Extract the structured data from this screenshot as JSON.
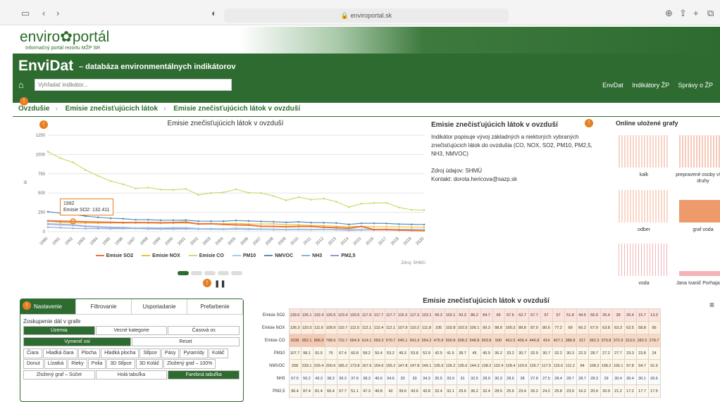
{
  "browser": {
    "url": "enviroportal.sk"
  },
  "site": {
    "logo_left": "enviro",
    "logo_right": "portál",
    "logo_sub": "Informačný portál rezortu MŽP SR",
    "app_title": "EnviDat",
    "app_subtitle": "– databáza environmentálnych indikátorov",
    "search_placeholder": "Vyhľadať indikátor...",
    "links": [
      "EnvDat",
      "Indikátory ŽP",
      "Správy o ŽP"
    ]
  },
  "breadcrumbs": [
    "Ovzdušie",
    "Emisie znečisťujúcich látok",
    "Emisie znečisťujúcich látok v ovzduší"
  ],
  "chart_data": {
    "type": "line",
    "title": "Emisie znečisťujúcich látok v ovzduší",
    "ylabel": "kt",
    "x": [
      1990,
      1991,
      1992,
      1993,
      1994,
      1995,
      1996,
      1997,
      1998,
      1999,
      2000,
      2001,
      2002,
      2003,
      2004,
      2005,
      2006,
      2007,
      2008,
      2009,
      2010,
      2011,
      2012,
      2013,
      2014,
      2015,
      2016,
      2017,
      2018,
      2019,
      2020
    ],
    "ylim": [
      0,
      1250
    ],
    "yticks": [
      0,
      250,
      500,
      750,
      1000,
      1250
    ],
    "grid": true,
    "legend": "bottom",
    "series": [
      {
        "name": "Emisie SO2",
        "color": "#e8743b",
        "values": [
          139.6,
          135.1,
          132.4,
          126.5,
          123.4,
          120.5,
          117.9,
          117.7,
          117.7,
          115.3,
          117.3,
          123.1,
          99.3,
          102.1,
          93.3,
          86.2,
          84.7,
          69,
          67.6,
          62.7,
          67.7,
          67,
          57,
          51.8,
          44.5,
          66.9,
          26.4,
          28,
          20.4,
          15.7,
          13.3
        ]
      },
      {
        "name": "Emisie NOX",
        "color": "#f2c037",
        "values": [
          136.3,
          120.3,
          111.6,
          109.9,
          110.7,
          112.5,
          112.1,
          112.4,
          112.1,
          107.9,
          110.2,
          111.8,
          105,
          102.8,
          102.5,
          106.1,
          99.3,
          98.8,
          100.3,
          89.8,
          87.9,
          80.6,
          77.2,
          69,
          66.2,
          67.9,
          63.8,
          63.3,
          62.5,
          58.8,
          56
        ]
      },
      {
        "name": "Emisie CO",
        "color": "#c9dd74",
        "values": [
          1036,
          952.1,
          896.9,
          798.6,
          722.7,
          654.9,
          614.1,
          559.3,
          570.7,
          545.1,
          541.6,
          554.2,
          475.9,
          500.8,
          508.2,
          548.8,
          503.8,
          500,
          461.5,
          405.4,
          446.8,
          414,
          427.1,
          388.8,
          317,
          362.3,
          370.8,
          372.9,
          313.6,
          282.5,
          278.7
        ]
      },
      {
        "name": "PM10",
        "color": "#9ed2e8",
        "values": [
          107.7,
          98.1,
          91.5,
          76,
          67.4,
          60.8,
          58.2,
          50.4,
          53.2,
          49.3,
          53.8,
          52.9,
          42.5,
          41.5,
          38.7,
          45,
          40.9,
          36.2,
          33.2,
          30.7,
          32.9,
          30.7,
          32.2,
          30.3,
          22.3,
          28.7,
          27.2,
          27.7,
          23.3,
          23.8,
          24
        ]
      },
      {
        "name": "NMVOC",
        "color": "#5a8fbd",
        "values": [
          258,
          239.1,
          226.4,
          200.6,
          185.2,
          173.8,
          167.6,
          154.6,
          155.2,
          147.8,
          147.8,
          149.1,
          135.9,
          135.2,
          135.6,
          144.3,
          138.2,
          132.4,
          128.4,
          120.6,
          126.7,
          117.5,
          115.6,
          111.2,
          94,
          108.3,
          108.2,
          106.1,
          97.8,
          94.7,
          91.6
        ]
      },
      {
        "name": "NH3",
        "color": "#8bb1d6",
        "values": [
          57.5,
          50.2,
          43.3,
          38.3,
          39.3,
          37.9,
          38.3,
          40.6,
          34.6,
          33,
          33,
          34.3,
          35.5,
          33.9,
          31,
          32.5,
          28.9,
          30.3,
          28.6,
          28,
          27.8,
          27.5,
          28.4,
          28.7,
          28.7,
          28.3,
          29,
          30.4,
          30.4,
          30.1,
          26.6
        ]
      },
      {
        "name": "PM2,5",
        "color": "#a78bd8",
        "values": [
          96.4,
          87.4,
          81.4,
          66.4,
          57.7,
          51.1,
          47.3,
          40.8,
          42,
          39.6,
          43.6,
          42.8,
          32.4,
          32.1,
          29.6,
          36.2,
          32.4,
          28.5,
          25.6,
          23.4,
          26.2,
          24.2,
          25.8,
          23.9,
          16.2,
          20.9,
          20.9,
          21.2,
          17.2,
          17.7,
          17.5
        ]
      }
    ],
    "tooltip": {
      "year": "1992",
      "text": "Emisie SO2: 132.411"
    },
    "source": "Zdroj: SHMÚ"
  },
  "info": {
    "title": "Emisie znečisťujúcich látok v ovzduší",
    "desc": "Indikátor popisuje vývoj základných a niektorých vybraných znečisťujúcich látok do ovzdušia (CO, NOX, SO2, PM10, PM2,5, NH3, NMVOC)",
    "source": "Zdroj údajov: SHMÚ",
    "contact": "Kontakt: dorota.hericova@sazp.sk"
  },
  "saved": {
    "title": "Online uložené grafy",
    "items": [
      "kalk",
      "prepravené osoby všetky druhy",
      "odber",
      "graf voda",
      "voda",
      "Jana Ivanič Porhajašová"
    ]
  },
  "panel": {
    "tabs": [
      "Nastavenie",
      "Filtrovanie",
      "Usporiadanie",
      "Prefarbenie"
    ],
    "group_label": "Zoskupenie dát v grafe",
    "group": [
      "Územia",
      "Vecné kategorie",
      "Časová os"
    ],
    "swap": "Vymeniť osi",
    "reset": "Reset",
    "types": [
      "Čiara",
      "Hladká čiara",
      "Plocha",
      "Hladká plocha",
      "Stĺpce",
      "Pásy",
      "Pyramídy",
      "Koláč",
      "Donut",
      "Lízatká",
      "Rieky",
      "Polia",
      "3D Stĺpce",
      "3D Koláč",
      "Zložený graf – 100%"
    ],
    "bottom": [
      "Zložený graf – Súčet",
      "Holá tabuľka",
      "Farebná tabuľka"
    ]
  },
  "table": {
    "title": "Emisie znečisťujúcich látok v ovzduší",
    "rows": [
      "Emisie SO2",
      "Emisie NOX",
      "Emisie CO",
      "PM10",
      "NMVOC",
      "NH3",
      "PM2,5"
    ]
  }
}
